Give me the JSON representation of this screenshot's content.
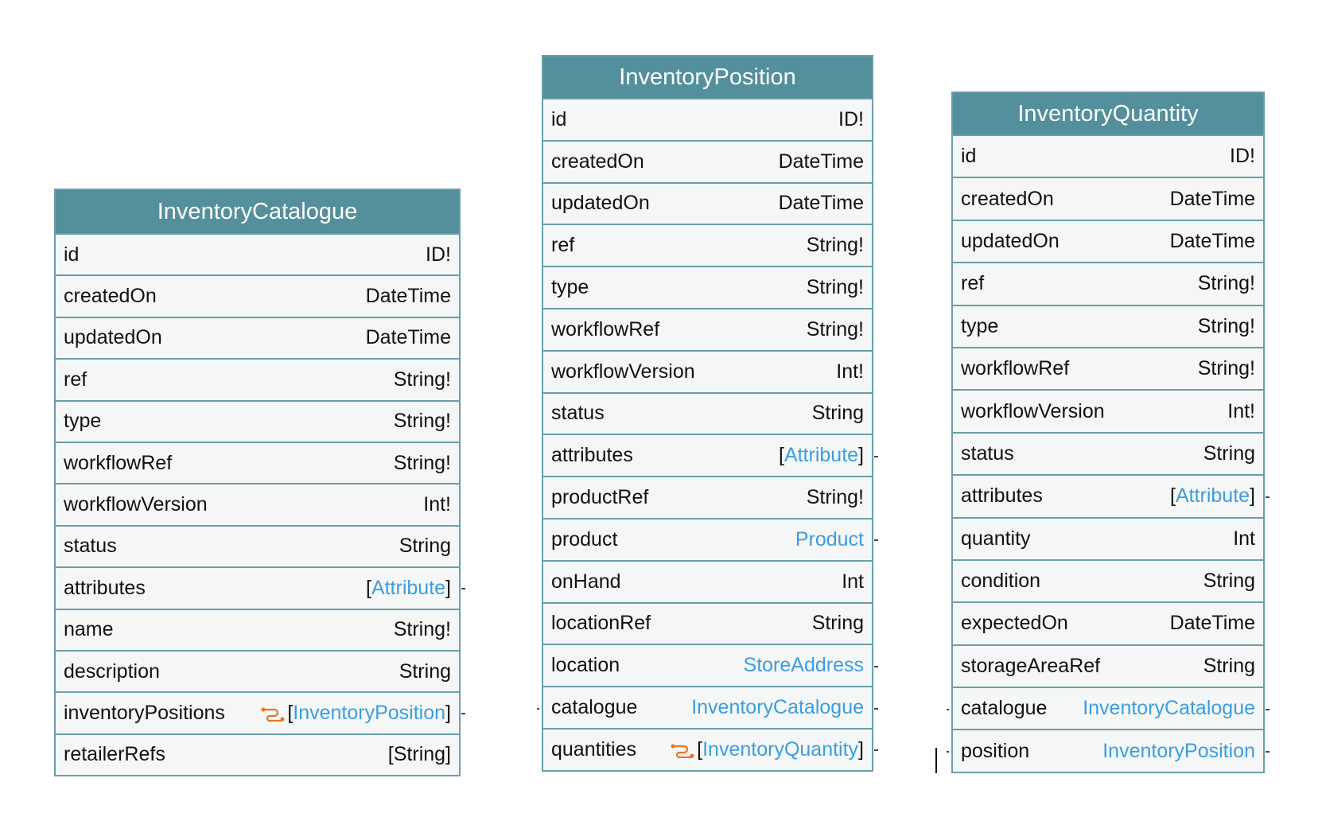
{
  "tables": [
    {
      "title": "InventoryCatalogue",
      "fields": [
        {
          "name": "id",
          "type": "ID!"
        },
        {
          "name": "createdOn",
          "type": "DateTime"
        },
        {
          "name": "updatedOn",
          "type": "DateTime"
        },
        {
          "name": "ref",
          "type": "String!"
        },
        {
          "name": "type",
          "type": "String!"
        },
        {
          "name": "workflowRef",
          "type": "String!"
        },
        {
          "name": "workflowVersion",
          "type": "Int!"
        },
        {
          "name": "status",
          "type": "String"
        },
        {
          "name": "attributes",
          "type": "Attribute",
          "list": true,
          "link": true
        },
        {
          "name": "name",
          "type": "String!"
        },
        {
          "name": "description",
          "type": "String"
        },
        {
          "name": "inventoryPositions",
          "type": "InventoryPosition",
          "list": true,
          "link": true,
          "relation": true
        },
        {
          "name": "retailerRefs",
          "type": "[String]"
        }
      ]
    },
    {
      "title": "InventoryPosition",
      "fields": [
        {
          "name": "id",
          "type": "ID!"
        },
        {
          "name": "createdOn",
          "type": "DateTime"
        },
        {
          "name": "updatedOn",
          "type": "DateTime"
        },
        {
          "name": "ref",
          "type": "String!"
        },
        {
          "name": "type",
          "type": "String!"
        },
        {
          "name": "workflowRef",
          "type": "String!"
        },
        {
          "name": "workflowVersion",
          "type": "Int!"
        },
        {
          "name": "status",
          "type": "String"
        },
        {
          "name": "attributes",
          "type": "Attribute",
          "list": true,
          "link": true
        },
        {
          "name": "productRef",
          "type": "String!"
        },
        {
          "name": "product",
          "type": "Product",
          "link": true
        },
        {
          "name": "onHand",
          "type": "Int"
        },
        {
          "name": "locationRef",
          "type": "String"
        },
        {
          "name": "location",
          "type": "StoreAddress",
          "link": true
        },
        {
          "name": "catalogue",
          "type": "InventoryCatalogue",
          "link": true
        },
        {
          "name": "quantities",
          "type": "InventoryQuantity",
          "list": true,
          "link": true,
          "relation": true
        }
      ]
    },
    {
      "title": "InventoryQuantity",
      "fields": [
        {
          "name": "id",
          "type": "ID!"
        },
        {
          "name": "createdOn",
          "type": "DateTime"
        },
        {
          "name": "updatedOn",
          "type": "DateTime"
        },
        {
          "name": "ref",
          "type": "String!"
        },
        {
          "name": "type",
          "type": "String!"
        },
        {
          "name": "workflowRef",
          "type": "String!"
        },
        {
          "name": "workflowVersion",
          "type": "Int!"
        },
        {
          "name": "status",
          "type": "String"
        },
        {
          "name": "attributes",
          "type": "Attribute",
          "list": true,
          "link": true
        },
        {
          "name": "quantity",
          "type": "Int"
        },
        {
          "name": "condition",
          "type": "String"
        },
        {
          "name": "expectedOn",
          "type": "DateTime"
        },
        {
          "name": "storageAreaRef",
          "type": "String"
        },
        {
          "name": "catalogue",
          "type": "InventoryCatalogue",
          "link": true
        },
        {
          "name": "position",
          "type": "InventoryPosition",
          "link": true
        }
      ]
    }
  ],
  "colors": {
    "header": "#548f9c",
    "border": "#6a9eab",
    "link": "#3b9ede",
    "relation_icon": "#f07020"
  }
}
